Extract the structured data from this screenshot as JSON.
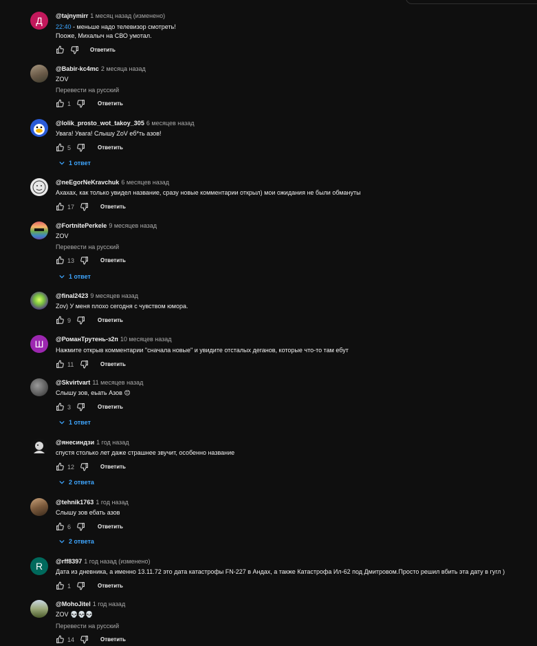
{
  "comments": [
    {
      "author": "@tajnymirr",
      "time": "1 месяц назад (изменено)",
      "lines": [
        "- меньше надо телевизор смотреть!",
        "Пооже, Михалыч на СВО умотал."
      ],
      "timestamp": "22:40",
      "likes": "",
      "translate": "",
      "replies": "",
      "avatar_letter": "Д",
      "avatar_color": "#c2185b"
    },
    {
      "author": "@Babir-kc4mc",
      "time": "2 месяца назад",
      "lines": [
        "ZOV"
      ],
      "likes": "1",
      "translate": "Перевести на русский",
      "replies": "",
      "avatar_letter": "",
      "avatar_color": "#8a7a6a"
    },
    {
      "author": "@lolik_prosto_wot_takoy_305",
      "time": "6 месяцев назад",
      "lines": [
        "Увага! Увага! Слышу ZoV еб*ть азов!"
      ],
      "likes": "5",
      "translate": "",
      "replies": "1 ответ",
      "avatar_letter": "",
      "avatar_color": "#2a5bd7"
    },
    {
      "author": "@neEgorNeKravchuk",
      "time": "6 месяцев назад",
      "lines": [
        "Ахахах, как только увидел название, сразу новые комментарии открыл) мои ожидания не были обмануты"
      ],
      "likes": "17",
      "translate": "",
      "replies": "",
      "avatar_letter": "",
      "avatar_color": "#e8e8e8"
    },
    {
      "author": "@FortnitePerkele",
      "time": "9 месяцев назад",
      "lines": [
        "ZOV"
      ],
      "likes": "13",
      "translate": "Перевести на русский",
      "replies": "1 ответ",
      "avatar_letter": "",
      "avatar_color": "#6aa84f"
    },
    {
      "author": "@final2423",
      "time": "9 месяцев назад",
      "lines": [
        "Zov) У меня плохо сегодня с чувством юмора."
      ],
      "likes": "9",
      "translate": "",
      "replies": "",
      "avatar_letter": "",
      "avatar_color": "#7cc242"
    },
    {
      "author": "@РоманТрутень-з2п",
      "time": "10 месяцев назад",
      "lines": [
        "Нажмите открыв комментарии \"сначала новые\" и увидите отсталых деганов, которые что-то там ебут"
      ],
      "likes": "11",
      "translate": "",
      "replies": "",
      "avatar_letter": "Ш",
      "avatar_color": "#9c27b0"
    },
    {
      "author": "@Skvirtvart",
      "time": "11 месяцев назад",
      "lines": [
        "Слышу зов, еьать Азов 😊"
      ],
      "likes": "3",
      "translate": "",
      "replies": "1 ответ",
      "avatar_letter": "",
      "avatar_color": "#6d6d6d"
    },
    {
      "author": "@янесиндзи",
      "time": "1 год назад",
      "lines": [
        "спустя столько лет даже страшнее звучит, особенно название"
      ],
      "likes": "12",
      "translate": "",
      "replies": "2 ответа",
      "avatar_letter": "",
      "avatar_color": "#d8d8d8"
    },
    {
      "author": "@tehnik1763",
      "time": "1 год назад",
      "lines": [
        "Слышу зов ебать азов"
      ],
      "likes": "6",
      "translate": "",
      "replies": "2 ответа",
      "avatar_letter": "",
      "avatar_color": "#7b5a3c"
    },
    {
      "author": "@rff8397",
      "time": "1 год назад (изменено)",
      "lines": [
        "Дата из дневника, а именно 13.11.72 это дата катастрофы FN-227 в Андах, а также Катастрофа Ил-62 под Дмитровом.Просто решил вбить эта дату в гугл )"
      ],
      "likes": "1",
      "translate": "",
      "replies": "",
      "avatar_letter": "R",
      "avatar_color": "#00695c"
    },
    {
      "author": "@MohoJitel",
      "time": "1 год назад",
      "lines": [
        "ZOV 💀💀💀"
      ],
      "likes": "14",
      "translate": "Перевести на русский",
      "replies": "",
      "avatar_letter": "",
      "avatar_color": "#7a8a5a"
    }
  ],
  "reply_label": "Ответить",
  "icons": {
    "like": "thumb-up-icon",
    "dislike": "thumb-down-icon",
    "expand": "chevron-down-icon"
  }
}
